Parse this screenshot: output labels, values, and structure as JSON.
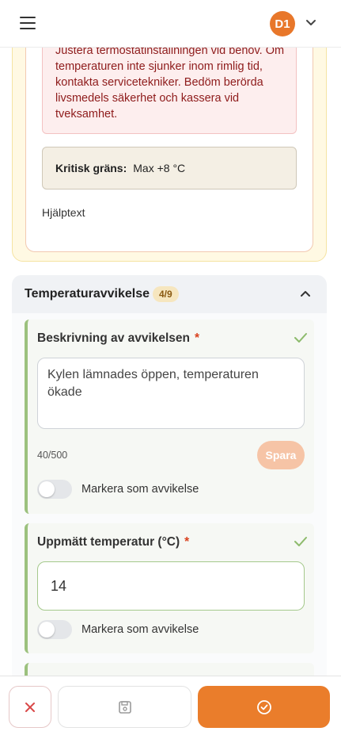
{
  "header": {
    "avatar_initials": "D1",
    "menu_icon": "hamburger-icon",
    "avatar_menu_icon": "chevron-down-icon"
  },
  "previous_section": {
    "alert_text": "Justera termostatinställningen vid behov. Om temperaturen inte sjunker inom rimlig tid, kontakta servicetekniker. Bedöm berörda livsmedels säkerhet och kassera vid tveksamhet.",
    "critical_limit_label": "Kritisk gräns:",
    "critical_limit_value": "Max +8 °C",
    "help_text": "Hjälptext"
  },
  "section": {
    "title": "Temperaturavvikelse",
    "progress_badge": "4/9",
    "collapse_icon": "chevron-up-icon"
  },
  "fields": [
    {
      "label": "Beskrivning av avvikelsen",
      "required_marker": "*",
      "value": "Kylen lämnades öppen, temperaturen ökade",
      "counter": "40/500",
      "save_label": "Spara",
      "toggle_label": "Markera som avvikelse",
      "toggle_on": false,
      "status_icon": "check-icon"
    },
    {
      "label": "Uppmätt temperatur (°C)",
      "required_marker": "*",
      "value": "14",
      "toggle_label": "Markera som avvikelse",
      "toggle_on": false,
      "status_icon": "check-icon"
    }
  ],
  "actions": {
    "cancel_icon": "close-icon",
    "save_icon": "floppy-disk-icon",
    "submit_icon": "check-circle-icon"
  },
  "colors": {
    "accent": "#ea7d2b",
    "valid": "#9cc17e",
    "alert_text": "#8e1b1b"
  }
}
